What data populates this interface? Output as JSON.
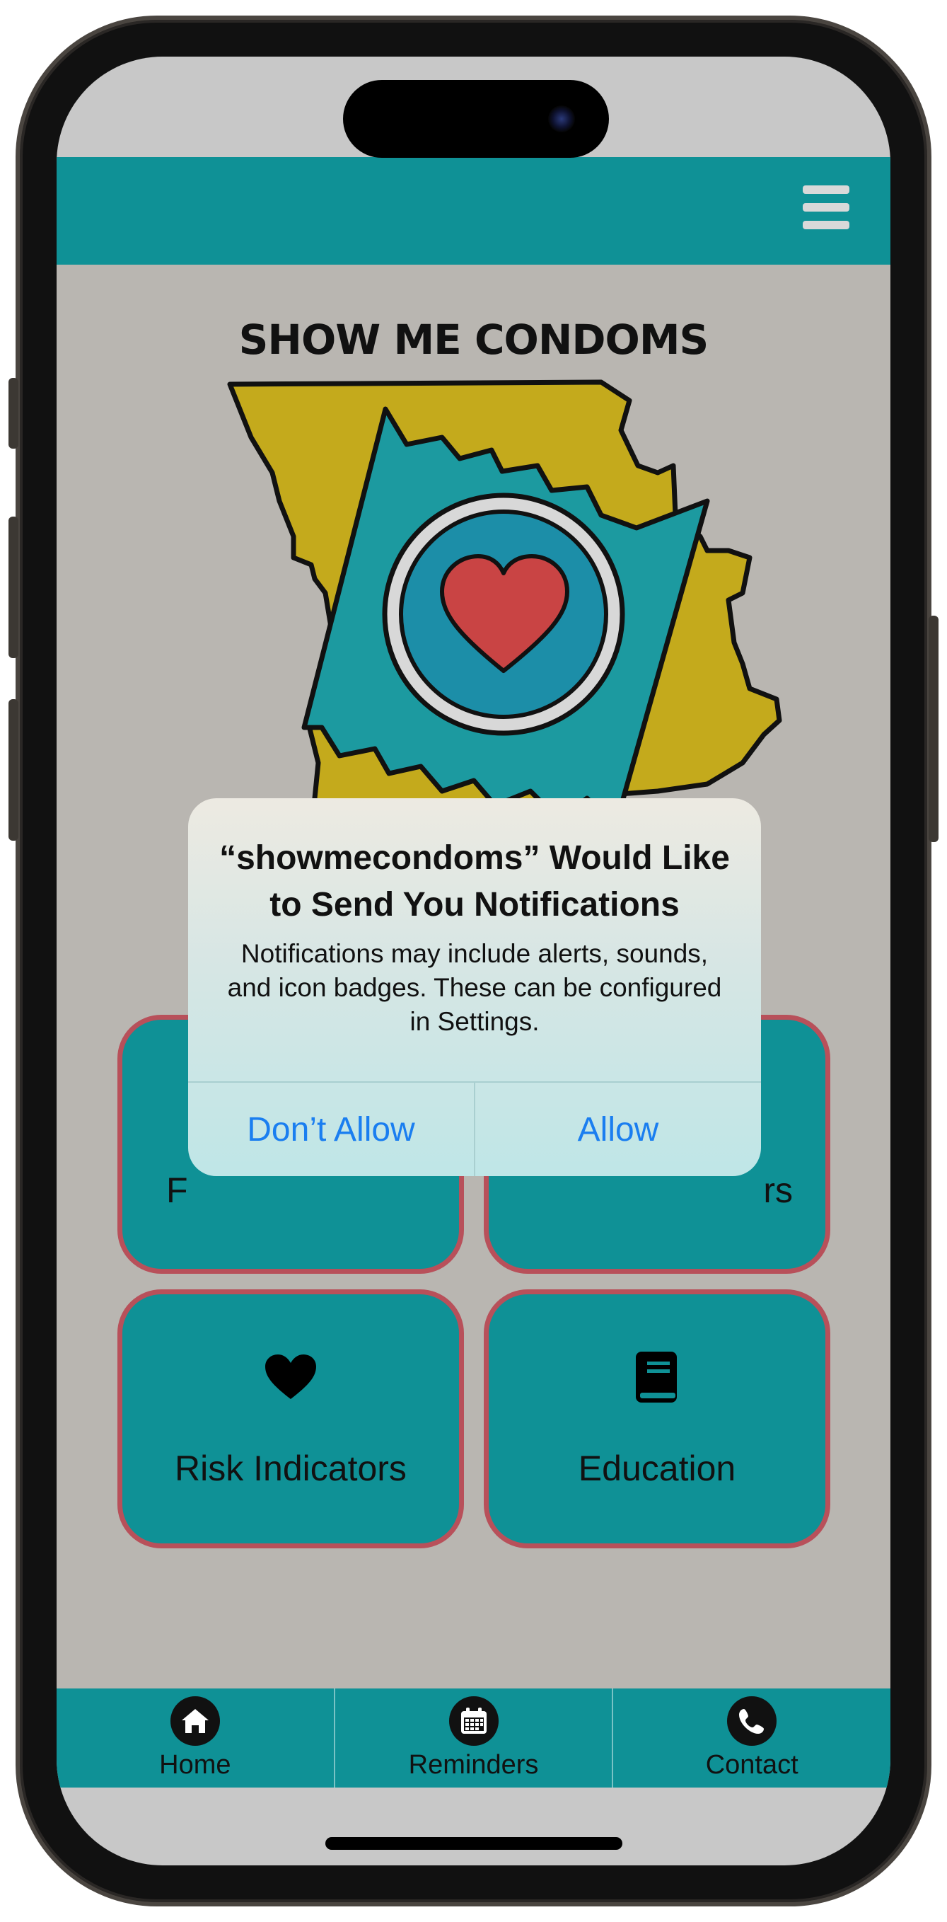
{
  "app": {
    "brand": "SHOW ME CONDOMS",
    "accent_color": "#0f9196",
    "tile_border_color": "#b8505a",
    "content_bg": "#b9b6b1",
    "menu_icon": "hamburger-menu-icon"
  },
  "tiles": [
    {
      "label": "Risk Indicators",
      "icon": "heart-icon"
    },
    {
      "label": "Education",
      "icon": "book-icon"
    }
  ],
  "partial_tiles": {
    "left_visible_text": "F",
    "right_visible_text": "rs"
  },
  "bottom_nav": [
    {
      "label": "Home",
      "icon": "home-icon"
    },
    {
      "label": "Reminders",
      "icon": "calendar-icon"
    },
    {
      "label": "Contact",
      "icon": "phone-icon"
    }
  ],
  "alert": {
    "title": "“showmecondoms” Would Like to Send You Notifications",
    "message": "Notifications may include alerts, sounds, and icon badges. These can be configured in Settings.",
    "deny_label": "Don’t Allow",
    "allow_label": "Allow",
    "button_color": "#1a7ef0"
  }
}
